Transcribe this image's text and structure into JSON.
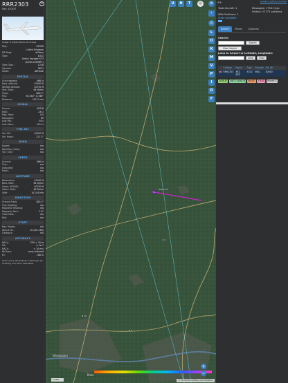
{
  "info": {
    "callsign": "RRR2303",
    "hex_line": "Hex: 43C8F7",
    "photo_caption": "Image © Adolfo Bento de Urquia",
    "details": [
      {
        "k": "Reg.:",
        "v": "ZZ336"
      },
      {
        "k": "",
        "v": "United Kingdom"
      },
      {
        "k": "DB flags:",
        "v": "military"
      },
      {
        "k": "Type:",
        "v": "A332"
      },
      {
        "k": "",
        "v": "Airbus Voyager KC3"
      },
      {
        "k": "",
        "v": "(A330-243MRTT)"
      },
      {
        "k": "Type Desc.:",
        "v": "L2J-B"
      },
      {
        "k": "Squawk:",
        "v": "6611"
      },
      {
        "k": "Route:",
        "v": "AKT-BZZ"
      }
    ],
    "sections": [
      {
        "title": "SPATIAL",
        "rows": [
          {
            "k": "Groundspeed:",
            "v": "466 kt"
          },
          {
            "k": "Baro. altitude:",
            "v": "40000 ft"
          },
          {
            "k": "WGS84 altitude:",
            "v": "40700 ft"
          },
          {
            "k": "Vert. Rate:",
            "v": "64 ft/min"
          },
          {
            "k": "Track:",
            "v": "280.3°"
          },
          {
            "k": "Pos.:",
            "v": "50.340°, 8.348°"
          },
          {
            "k": "Distance:",
            "v": "192.7 nmi"
          }
        ]
      },
      {
        "title": "SIGNAL",
        "rows": [
          {
            "k": "Source:",
            "v": "ADS-B"
          },
          {
            "k": "RSSI:",
            "v": "-26.1"
          },
          {
            "k": "Msg. Rate:",
            "v": "0.0"
          },
          {
            "k": "Messages:",
            "v": "89"
          },
          {
            "k": "Last Pos.:",
            "v": "30 s"
          },
          {
            "k": "Last Seen:",
            "v": "16.4 s"
          }
        ]
      },
      {
        "title": "FMS SEL",
        "rows": [
          {
            "k": "Sel. Alt.:",
            "v": "40000 ft"
          },
          {
            "k": "Sel. Head.:",
            "v": "217.3°"
          }
        ]
      },
      {
        "title": "WIND",
        "rows": [
          {
            "k": "Speed:",
            "v": "n/a"
          },
          {
            "k": "Direction (from):",
            "v": "n/a"
          },
          {
            "k": "TAT / OAT:",
            "v": "n/a"
          }
        ]
      },
      {
        "title": "SPEED",
        "rows": [
          {
            "k": "Ground:",
            "v": "466 kt"
          },
          {
            "k": "True:",
            "v": "n/a"
          },
          {
            "k": "Indicated:",
            "v": "n/a"
          },
          {
            "k": "Mach:",
            "v": "n/a"
          }
        ]
      },
      {
        "title": "ALTITUDE",
        "rows": [
          {
            "k": "Barometric:",
            "v": "40000 ft"
          },
          {
            "k": "Baro. Rate:",
            "v": "64 ft/min"
          },
          {
            "k": "Geom. WGS84:",
            "v": "40700 ft"
          },
          {
            "k": "Geom. Rate:",
            "v": "64 ft/min"
          },
          {
            "k": "QNH:",
            "v": "1013.6 hPa"
          }
        ]
      },
      {
        "title": "DIRECTION",
        "rows": [
          {
            "k": "Ground Track:",
            "v": "280.3°"
          },
          {
            "k": "True Heading:",
            "v": "n/a"
          },
          {
            "k": "Magnetic Heading:",
            "v": "n/a"
          },
          {
            "k": "Magnetic Decl.:",
            "v": "2.6°"
          },
          {
            "k": "Track Rate:",
            "v": "n/a"
          },
          {
            "k": "Roll:",
            "v": "n/a"
          }
        ]
      },
      {
        "title": "STUFF",
        "rows": [
          {
            "k": "Nav. Modes:",
            "v": "n/a"
          },
          {
            "k": "ADS-B Ver.:",
            "v": "v0 (DO-260)"
          },
          {
            "k": "Category:",
            "v": "n/a"
          }
        ]
      },
      {
        "title": "ACCURACY",
        "rows": [
          {
            "k": "NACp:",
            "v": "EPU < 30 m"
          },
          {
            "k": "SIL:",
            "v": "≤ 1e-7"
          },
          {
            "k": "NACv:",
            "v": "< 10 m/s"
          },
          {
            "k": "NICbaro:",
            "v": "cross-checked"
          },
          {
            "k": "Rc:",
            "v": "186 m"
          }
        ]
      }
    ],
    "learn_more": "Learn more about Mode S data type by hovering over each data label."
  },
  "map": {
    "top_buttons": [
      "U",
      "H",
      "T"
    ],
    "side_buttons": [
      "L",
      "O",
      "K",
      "M",
      "V",
      "P",
      "I",
      "R",
      "F"
    ],
    "place_labels": [
      "Wiesbaden",
      "Main",
      "B 49",
      "B 8",
      "A 3"
    ],
    "plane_label": "RRR2303",
    "attribution": "© OpenStreetMap contributors.",
    "scale": "2 NM",
    "altitude_ticks": [
      "",
      "",
      "",
      "",
      "",
      "",
      "",
      ""
    ],
    "zoom_in": "+",
    "zoom_out": "−"
  },
  "sidebar": {
    "version_link": "tar1090 on github (3.14.1651)",
    "stats": {
      "total_aircraft": "Total Aircraft: 1",
      "with_positions": "With Positions: 1",
      "messages": "Messages: 1754.7/sec",
      "history": "History: 27272 positions"
    },
    "stats_link": "Stats available",
    "tabs": [
      "Search",
      "Filters",
      "Columns"
    ],
    "search_label": "Search:",
    "search_button": "Search",
    "clear_search": "Clear Search",
    "jump_label": "Jump to Airport or Latitude, Longitude:",
    "jump_button": "Jump",
    "clear_button": "Clear",
    "table_headers": [
      "",
      "Callsign",
      "Route",
      "Type",
      "Squawk",
      "Alt. (ft)"
    ],
    "table_row": [
      "🇬🇧",
      "RRR2303",
      "AKT-BZZ",
      "A332",
      "6611",
      "40000"
    ],
    "legend": [
      {
        "label": "ADS-B",
        "color": "#9ad27a"
      },
      {
        "label": "UAT / ADS-R",
        "color": "#8fd0a0"
      },
      {
        "label": "MLAT",
        "color": "#e8a06a"
      },
      {
        "label": "TIS-B",
        "color": "#f29ab8"
      },
      {
        "label": "Mode-S",
        "color": "#d0d0d0"
      }
    ]
  },
  "colors": {
    "accent": "#58b2ff",
    "button": "#3a7fc1",
    "track": "#d020d0"
  }
}
